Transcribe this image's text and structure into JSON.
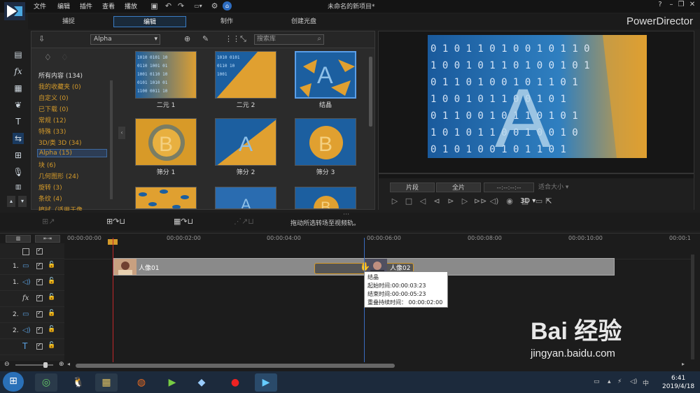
{
  "menu": [
    "文件",
    "编辑",
    "插件",
    "查看",
    "播放"
  ],
  "doc_title": "未命名的新项目*",
  "brand": "PowerDirector",
  "modes": [
    "捕捉",
    "编辑",
    "制作",
    "创建光盘"
  ],
  "library": {
    "filter": "Alpha",
    "search_placeholder": "搜索库",
    "categories": [
      "所有内容 (134)",
      "我的收藏夹 (0)",
      "自定义 (0)",
      "已下载 (0)",
      "常规 (12)",
      "特殊 (33)",
      "3D/类 3D (34)",
      "Alpha (15)",
      "块 (6)",
      "几何图形 (24)",
      "旋转 (3)",
      "条纹 (4)",
      "擦拭（适用于像..."
    ],
    "thumbs": [
      "二元 1",
      "二元 2",
      "结晶",
      "筛分 1",
      "筛分 2",
      "筛分 3"
    ]
  },
  "preview": {
    "btn_clip": "片段",
    "btn_full": "全片",
    "timecode": "--:--:--:--",
    "fit": "适合大小",
    "mode3d": "3D"
  },
  "hint": "拖动所选转场至视频轨。",
  "ruler": [
    "00:00:00:00",
    "00:00:02:00",
    "00:00:04:00",
    "00:00:06:00",
    "00:00:08:00",
    "00:00:10:00",
    "00:00:1"
  ],
  "tracks": [
    "1.",
    "1.",
    "",
    "2.",
    "2.",
    ""
  ],
  "clips": {
    "c1": "人像01",
    "c2": "人像02"
  },
  "tooltip": {
    "name": "结晶",
    "start": "起始时间:00:00:03:23",
    "end": "结束时间:00:00:05:23",
    "overlap": "重叠持续时间： 00:00:02:00"
  },
  "clock": {
    "time": "6:41",
    "date": "2019/4/18"
  },
  "watermark": {
    "main": "Bai  经验",
    "sub": "jingyan.baidu.com"
  },
  "colors": {
    "accent": "#3a7cc4",
    "category": "#d49a2a",
    "playhead": "#c0282a"
  }
}
